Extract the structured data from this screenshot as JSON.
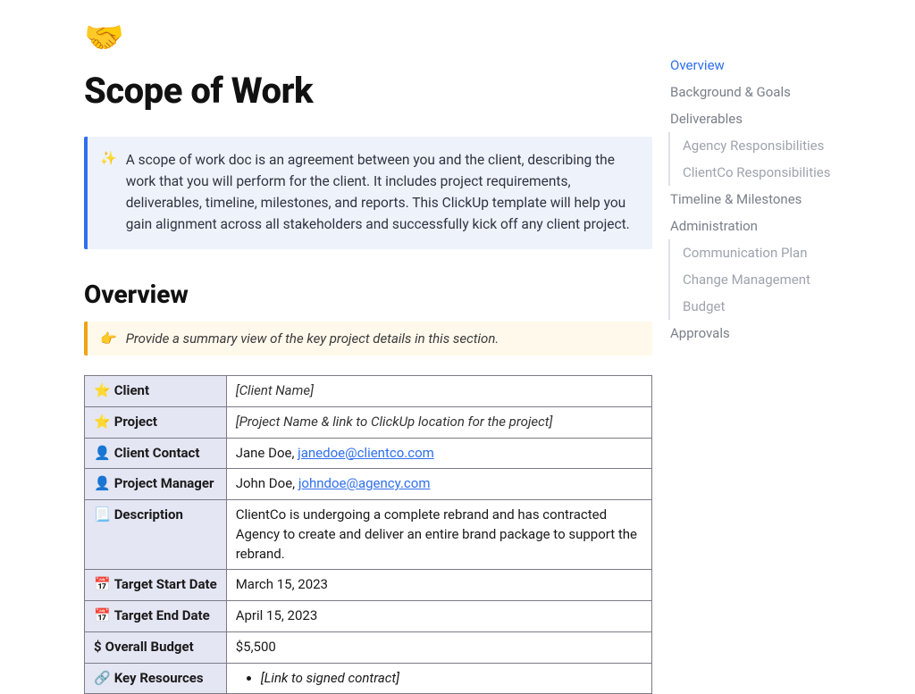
{
  "doc": {
    "emoji": "🤝",
    "title": "Scope of Work"
  },
  "intro_callout": {
    "icon_name": "sparkles-icon",
    "icon_glyph": "✨",
    "text": "A scope of work doc is an agreement between you and the client, describing the work that you will perform for the client. It includes project requirements, deliverables, timeline, milestones, and reports. This ClickUp template will help you gain alignment across all stakeholders and successfully kick off any client project."
  },
  "overview": {
    "heading": "Overview",
    "tip": {
      "icon_name": "point-right-icon",
      "icon_glyph": "👉",
      "text": "Provide a summary view of the key project details in this section."
    },
    "rows": [
      {
        "icon": "⭐",
        "label": "Client",
        "type": "placeholder",
        "value": "[Client Name]"
      },
      {
        "icon": "⭐",
        "label": "Project",
        "type": "placeholder",
        "value": "[Project Name & link to ClickUp location for the project]"
      },
      {
        "icon": "👤",
        "label": "Client Contact",
        "type": "contact",
        "name": "Jane Doe",
        "email": "janedoe@clientco.com"
      },
      {
        "icon": "👤",
        "label": "Project Manager",
        "type": "contact",
        "name": "John Doe",
        "email": "johndoe@agency.com"
      },
      {
        "icon": "📃",
        "label": "Description",
        "type": "text",
        "value": "ClientCo is undergoing a complete rebrand and has contracted Agency to create and deliver an entire brand package to support the rebrand."
      },
      {
        "icon": "📅",
        "label": "Target Start Date",
        "type": "text",
        "value": "March 15, 2023"
      },
      {
        "icon": "📅",
        "label": "Target End Date",
        "type": "text",
        "value": "April 15, 2023"
      },
      {
        "icon": "$",
        "label": "Overall Budget",
        "type": "text",
        "value": "$5,500"
      },
      {
        "icon": "🔗",
        "label": "Key Resources",
        "type": "list",
        "items": [
          "[Link to signed contract]"
        ]
      }
    ]
  },
  "toc": [
    {
      "label": "Overview",
      "active": true
    },
    {
      "label": "Background & Goals"
    },
    {
      "label": "Deliverables",
      "children": [
        {
          "label": "Agency Responsibilities"
        },
        {
          "label": "ClientCo Responsibilities"
        }
      ]
    },
    {
      "label": "Timeline & Milestones"
    },
    {
      "label": "Administration",
      "children": [
        {
          "label": "Communication Plan"
        },
        {
          "label": "Change Management"
        },
        {
          "label": "Budget"
        }
      ]
    },
    {
      "label": "Approvals"
    }
  ]
}
